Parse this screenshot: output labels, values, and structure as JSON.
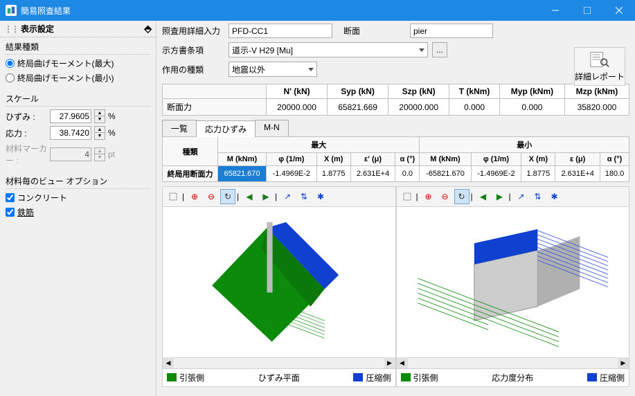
{
  "window": {
    "title": "簡易照査結果"
  },
  "sidebar": {
    "panel_title": "表示設定",
    "group_result": {
      "title": "結果種類",
      "opt_max": "終局曲げモーメント(最大)",
      "opt_min": "終局曲げモーメント(最小)"
    },
    "group_scale": {
      "title": "スケール",
      "strain_label": "ひずみ :",
      "strain_val": "27.9605",
      "strain_unit": "%",
      "stress_label": "応力 :",
      "stress_val": "38.7420",
      "stress_unit": "%",
      "marker_label": "材料マーカー :",
      "marker_val": "4",
      "marker_unit": "pt"
    },
    "group_view": {
      "title": "材料毎のビュー オプション",
      "opt_concrete": "コンクリート",
      "opt_rebar": "鉄筋"
    }
  },
  "main": {
    "labels": {
      "input": "照査用詳細入力",
      "section": "断面",
      "spec": "示方書条項",
      "action": "作用の種類"
    },
    "values": {
      "input": "PFD-CC1",
      "section": "pier",
      "spec": "道示-V H29 [Mu]",
      "action": "地震以外"
    },
    "report_btn": "詳細レポート",
    "force_table": {
      "headers": [
        "",
        "N' (kN)",
        "Syp (kN)",
        "Szp (kN)",
        "T (kNm)",
        "Myp (kNm)",
        "Mzp (kNm)"
      ],
      "row_label": "断面力",
      "values": [
        "20000.000",
        "65821.669",
        "20000.000",
        "0.000",
        "0.000",
        "35820.000"
      ]
    },
    "tabs": [
      "一覧",
      "応力ひずみ",
      "M-N"
    ],
    "result": {
      "rowhead": "種類",
      "group_max": "最大",
      "group_min": "最小",
      "cols_max": [
        "M (kNm)",
        "φ (1/m)",
        "X (m)",
        "ε' (μ)",
        "α (°)"
      ],
      "cols_min": [
        "M (kNm)",
        "φ (1/m)",
        "X (m)",
        "ε (μ)",
        "α (°)"
      ],
      "row_label": "終局用断面力",
      "vals_max": [
        "65821.670",
        "-1.4969E-2",
        "1.8775",
        "2.631E+4",
        "0.0"
      ],
      "vals_min": [
        "-65821.670",
        "-1.4969E-2",
        "1.8775",
        "2.631E+4",
        "180.0"
      ]
    },
    "legend": {
      "tension": "引張側",
      "plane": "ひずみ平面",
      "compression": "圧縮側",
      "stress": "応力度分布"
    }
  }
}
